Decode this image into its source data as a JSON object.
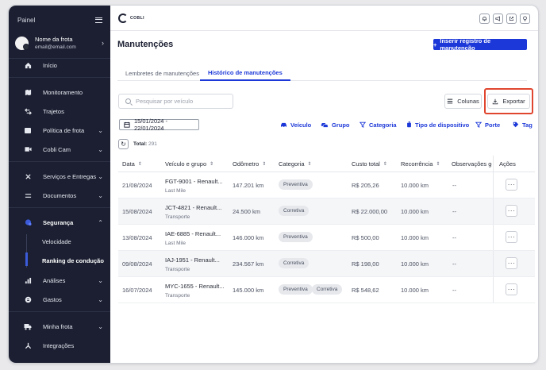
{
  "sidebar": {
    "title": "Painel",
    "user": {
      "name": "Nome da frota",
      "email": "email@email.com"
    },
    "items": [
      {
        "id": "inicio",
        "label": "Início",
        "icon": "home-icon"
      },
      {
        "id": "monitoramento",
        "label": "Monitoramento",
        "icon": "map-icon"
      },
      {
        "id": "trajetos",
        "label": "Trajetos",
        "icon": "route-icon"
      },
      {
        "id": "politica",
        "label": "Política de frota",
        "icon": "policy-icon"
      },
      {
        "id": "cobli-cam",
        "label": "Cobli Cam",
        "icon": "camera-icon"
      },
      {
        "id": "servicos",
        "label": "Serviços e Entregas",
        "icon": "services-icon"
      },
      {
        "id": "documentos",
        "label": "Documentos",
        "icon": "documents-icon"
      },
      {
        "id": "seguranca",
        "label": "Segurança",
        "icon": "shield-icon"
      },
      {
        "id": "analises",
        "label": "Análises",
        "icon": "chart-icon"
      },
      {
        "id": "gastos",
        "label": "Gastos",
        "icon": "money-icon"
      },
      {
        "id": "minha-frota",
        "label": "Minha frota",
        "icon": "truck-icon"
      },
      {
        "id": "integracoes",
        "label": "Integrações",
        "icon": "integration-icon"
      }
    ],
    "seguranca_sub": [
      "Velocidade",
      "Ranking de condução"
    ]
  },
  "topbar": {
    "logo_text": "COBLI"
  },
  "main": {
    "title": "Manutenções",
    "primary_button": "Inserir registro de manutenção",
    "tabs": [
      "Lembretes de manutenções",
      "Histórico de manutenções"
    ],
    "search_placeholder": "Pesquisar por veículo",
    "columns_button": "Colunas",
    "export_button": "Exportar",
    "date_range": "15/01/2024 - 22/01/2024",
    "filters": [
      "Veículo",
      "Grupo",
      "Categoria",
      "Tipo de dispositivo",
      "Porte",
      "Tag"
    ],
    "total_label": "Total:",
    "total_value": "291"
  },
  "table": {
    "headers": [
      "Data",
      "Veículo e grupo",
      "Odômetro",
      "Categoria",
      "Custo total",
      "Recorrência",
      "Observações gerais",
      "Ações"
    ],
    "rows": [
      {
        "date": "21/08/2024",
        "vehicle": "FGT-9001 - Renault...",
        "group": "Last Mile",
        "odometer": "147.201 km",
        "categories": [
          "Preventiva"
        ],
        "cost": "R$ 205,26",
        "recurrence": "10.000 km",
        "notes": "--"
      },
      {
        "date": "15/08/2024",
        "vehicle": "JCT-4821 - Renault...",
        "group": "Transporte",
        "odometer": "24.500 km",
        "categories": [
          "Corretiva"
        ],
        "cost": "R$ 22.000,00",
        "recurrence": "10.000 km",
        "notes": "--"
      },
      {
        "date": "13/08/2024",
        "vehicle": "IAE-6885 - Renault...",
        "group": "Last Mile",
        "odometer": "146.000 km",
        "categories": [
          "Preventiva"
        ],
        "cost": "R$ 500,00",
        "recurrence": "10.000 km",
        "notes": "--"
      },
      {
        "date": "09/08/2024",
        "vehicle": "IAJ-1951 - Renault...",
        "group": "Transporte",
        "odometer": "234.567 km",
        "categories": [
          "Corretiva"
        ],
        "cost": "R$ 198,00",
        "recurrence": "10.000 km",
        "notes": "--"
      },
      {
        "date": "16/07/2024",
        "vehicle": "MYC-1655 - Renault...",
        "group": "Transporte",
        "odometer": "145.000 km",
        "categories": [
          "Preventiva",
          "Corretiva"
        ],
        "cost": "R$ 548,62",
        "recurrence": "10.000 km",
        "notes": "--"
      }
    ]
  },
  "colors": {
    "primary": "#1c38d8",
    "sidebar_bg": "#1b1f31",
    "highlight": "#e0462f"
  }
}
